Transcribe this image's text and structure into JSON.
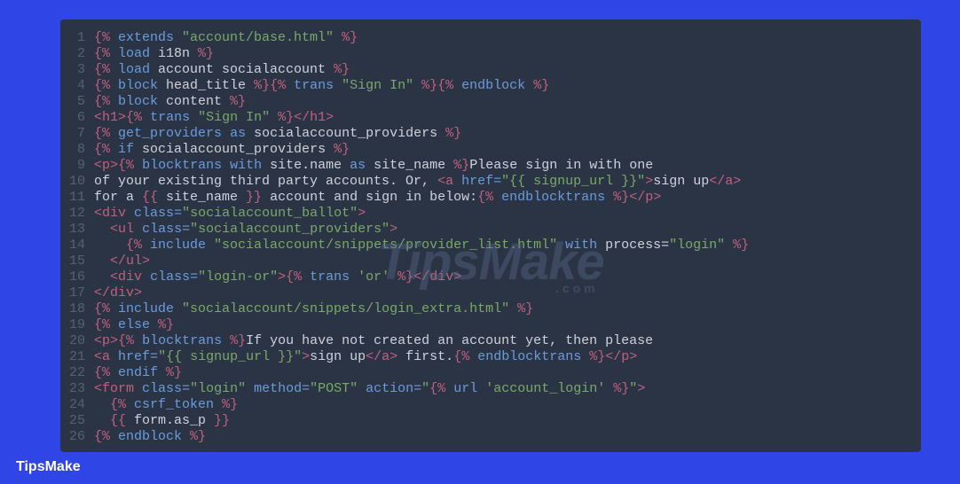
{
  "footer": "TipsMake",
  "watermark": {
    "main": "TipsMake",
    "sub": ".com"
  },
  "lines": [
    {
      "n": 1,
      "tokens": [
        [
          "{% ",
          "delim"
        ],
        [
          "extends",
          "kw"
        ],
        [
          " \"account/base.html\" ",
          "str"
        ],
        [
          "%}",
          "delim"
        ]
      ]
    },
    {
      "n": 2,
      "tokens": [
        [
          "{% ",
          "delim"
        ],
        [
          "load",
          "kw"
        ],
        [
          " i18n ",
          "plain"
        ],
        [
          "%}",
          "delim"
        ]
      ]
    },
    {
      "n": 3,
      "tokens": [
        [
          "{% ",
          "delim"
        ],
        [
          "load",
          "kw"
        ],
        [
          " account socialaccount ",
          "plain"
        ],
        [
          "%}",
          "delim"
        ]
      ]
    },
    {
      "n": 4,
      "tokens": [
        [
          "{% ",
          "delim"
        ],
        [
          "block",
          "kw"
        ],
        [
          " head_title ",
          "plain"
        ],
        [
          "%}",
          "delim"
        ],
        [
          "{% ",
          "delim"
        ],
        [
          "trans",
          "kw"
        ],
        [
          " \"Sign In\" ",
          "str"
        ],
        [
          "%}",
          "delim"
        ],
        [
          "{% ",
          "delim"
        ],
        [
          "endblock",
          "kw"
        ],
        [
          " ",
          "plain"
        ],
        [
          "%}",
          "delim"
        ]
      ]
    },
    {
      "n": 5,
      "tokens": [
        [
          "{% ",
          "delim"
        ],
        [
          "block",
          "kw"
        ],
        [
          " content ",
          "plain"
        ],
        [
          "%}",
          "delim"
        ]
      ]
    },
    {
      "n": 6,
      "tokens": [
        [
          "<",
          "htag"
        ],
        [
          "h1",
          "hname"
        ],
        [
          ">",
          "htag"
        ],
        [
          "{% ",
          "delim"
        ],
        [
          "trans",
          "kw"
        ],
        [
          " \"Sign In\" ",
          "str"
        ],
        [
          "%}",
          "delim"
        ],
        [
          "</",
          "htag"
        ],
        [
          "h1",
          "hname"
        ],
        [
          ">",
          "htag"
        ]
      ]
    },
    {
      "n": 7,
      "tokens": [
        [
          "{% ",
          "delim"
        ],
        [
          "get_providers",
          "kw"
        ],
        [
          " ",
          "plain"
        ],
        [
          "as",
          "kw"
        ],
        [
          " socialaccount_providers ",
          "plain"
        ],
        [
          "%}",
          "delim"
        ]
      ]
    },
    {
      "n": 8,
      "tokens": [
        [
          "{% ",
          "delim"
        ],
        [
          "if",
          "kw"
        ],
        [
          " socialaccount_providers ",
          "plain"
        ],
        [
          "%}",
          "delim"
        ]
      ]
    },
    {
      "n": 9,
      "tokens": [
        [
          "<",
          "htag"
        ],
        [
          "p",
          "hname"
        ],
        [
          ">",
          "htag"
        ],
        [
          "{% ",
          "delim"
        ],
        [
          "blocktrans",
          "kw"
        ],
        [
          " ",
          "plain"
        ],
        [
          "with",
          "kw"
        ],
        [
          " site.name ",
          "var"
        ],
        [
          "as",
          "kw"
        ],
        [
          " site_name ",
          "var"
        ],
        [
          "%}",
          "delim"
        ],
        [
          "Please sign in with one",
          "plain"
        ]
      ]
    },
    {
      "n": 10,
      "tokens": [
        [
          "of your existing third party accounts. Or, ",
          "plain"
        ],
        [
          "<",
          "htag"
        ],
        [
          "a",
          "hname"
        ],
        [
          " ",
          "plain"
        ],
        [
          "href=",
          "attr"
        ],
        [
          "\"{{ signup_url }}\"",
          "attrval"
        ],
        [
          ">",
          "htag"
        ],
        [
          "sign up",
          "plain"
        ],
        [
          "</",
          "htag"
        ],
        [
          "a",
          "hname"
        ],
        [
          ">",
          "htag"
        ]
      ]
    },
    {
      "n": 11,
      "tokens": [
        [
          "for a ",
          "plain"
        ],
        [
          "{{ ",
          "delim"
        ],
        [
          "site_name",
          "var"
        ],
        [
          " }}",
          "delim"
        ],
        [
          " account and sign in below:",
          "plain"
        ],
        [
          "{% ",
          "delim"
        ],
        [
          "endblocktrans",
          "kw"
        ],
        [
          " ",
          "plain"
        ],
        [
          "%}",
          "delim"
        ],
        [
          "</",
          "htag"
        ],
        [
          "p",
          "hname"
        ],
        [
          ">",
          "htag"
        ]
      ]
    },
    {
      "n": 12,
      "tokens": [
        [
          "<",
          "htag"
        ],
        [
          "div",
          "hname"
        ],
        [
          " ",
          "plain"
        ],
        [
          "class=",
          "attr"
        ],
        [
          "\"socialaccount_ballot\"",
          "attrval"
        ],
        [
          ">",
          "htag"
        ]
      ]
    },
    {
      "n": 13,
      "tokens": [
        [
          "  ",
          "plain"
        ],
        [
          "<",
          "htag"
        ],
        [
          "ul",
          "hname"
        ],
        [
          " ",
          "plain"
        ],
        [
          "class=",
          "attr"
        ],
        [
          "\"socialaccount_providers\"",
          "attrval"
        ],
        [
          ">",
          "htag"
        ]
      ]
    },
    {
      "n": 14,
      "tokens": [
        [
          "    ",
          "plain"
        ],
        [
          "{% ",
          "delim"
        ],
        [
          "include",
          "kw"
        ],
        [
          " \"socialaccount/snippets/provider_list.html\" ",
          "str"
        ],
        [
          "with",
          "kw"
        ],
        [
          " process=",
          "plain"
        ],
        [
          "\"login\" ",
          "str"
        ],
        [
          "%}",
          "delim"
        ]
      ]
    },
    {
      "n": 15,
      "tokens": [
        [
          "  ",
          "plain"
        ],
        [
          "</",
          "htag"
        ],
        [
          "ul",
          "hname"
        ],
        [
          ">",
          "htag"
        ]
      ]
    },
    {
      "n": 16,
      "tokens": [
        [
          "  ",
          "plain"
        ],
        [
          "<",
          "htag"
        ],
        [
          "div",
          "hname"
        ],
        [
          " ",
          "plain"
        ],
        [
          "class=",
          "attr"
        ],
        [
          "\"login-or\"",
          "attrval"
        ],
        [
          ">",
          "htag"
        ],
        [
          "{% ",
          "delim"
        ],
        [
          "trans",
          "kw"
        ],
        [
          " 'or' ",
          "str"
        ],
        [
          "%}",
          "delim"
        ],
        [
          "</",
          "htag"
        ],
        [
          "div",
          "hname"
        ],
        [
          ">",
          "htag"
        ]
      ]
    },
    {
      "n": 17,
      "tokens": [
        [
          "</",
          "htag"
        ],
        [
          "div",
          "hname"
        ],
        [
          ">",
          "htag"
        ]
      ]
    },
    {
      "n": 18,
      "tokens": [
        [
          "{% ",
          "delim"
        ],
        [
          "include",
          "kw"
        ],
        [
          " \"socialaccount/snippets/login_extra.html\" ",
          "str"
        ],
        [
          "%}",
          "delim"
        ]
      ]
    },
    {
      "n": 19,
      "tokens": [
        [
          "{% ",
          "delim"
        ],
        [
          "else",
          "kw"
        ],
        [
          " ",
          "plain"
        ],
        [
          "%}",
          "delim"
        ]
      ]
    },
    {
      "n": 20,
      "tokens": [
        [
          "<",
          "htag"
        ],
        [
          "p",
          "hname"
        ],
        [
          ">",
          "htag"
        ],
        [
          "{% ",
          "delim"
        ],
        [
          "blocktrans",
          "kw"
        ],
        [
          " ",
          "plain"
        ],
        [
          "%}",
          "delim"
        ],
        [
          "If you have not created an account yet, then please",
          "plain"
        ]
      ]
    },
    {
      "n": 21,
      "tokens": [
        [
          "<",
          "htag"
        ],
        [
          "a",
          "hname"
        ],
        [
          " ",
          "plain"
        ],
        [
          "href=",
          "attr"
        ],
        [
          "\"{{ signup_url }}\"",
          "attrval"
        ],
        [
          ">",
          "htag"
        ],
        [
          "sign up",
          "plain"
        ],
        [
          "</",
          "htag"
        ],
        [
          "a",
          "hname"
        ],
        [
          ">",
          "htag"
        ],
        [
          " first.",
          "plain"
        ],
        [
          "{% ",
          "delim"
        ],
        [
          "endblocktrans",
          "kw"
        ],
        [
          " ",
          "plain"
        ],
        [
          "%}",
          "delim"
        ],
        [
          "</",
          "htag"
        ],
        [
          "p",
          "hname"
        ],
        [
          ">",
          "htag"
        ]
      ]
    },
    {
      "n": 22,
      "tokens": [
        [
          "{% ",
          "delim"
        ],
        [
          "endif",
          "kw"
        ],
        [
          " ",
          "plain"
        ],
        [
          "%}",
          "delim"
        ]
      ]
    },
    {
      "n": 23,
      "tokens": [
        [
          "<",
          "htag"
        ],
        [
          "form",
          "hname"
        ],
        [
          " ",
          "plain"
        ],
        [
          "class=",
          "attr"
        ],
        [
          "\"login\"",
          "attrval"
        ],
        [
          " ",
          "plain"
        ],
        [
          "method=",
          "attr"
        ],
        [
          "\"POST\"",
          "attrval"
        ],
        [
          " ",
          "plain"
        ],
        [
          "action=",
          "attr"
        ],
        [
          "\"",
          "attrval"
        ],
        [
          "{% ",
          "delim"
        ],
        [
          "url",
          "kw"
        ],
        [
          " 'account_login' ",
          "str"
        ],
        [
          "%}",
          "delim"
        ],
        [
          "\"",
          "attrval"
        ],
        [
          ">",
          "htag"
        ]
      ]
    },
    {
      "n": 24,
      "tokens": [
        [
          "  ",
          "plain"
        ],
        [
          "{% ",
          "delim"
        ],
        [
          "csrf_token",
          "kw"
        ],
        [
          " ",
          "plain"
        ],
        [
          "%}",
          "delim"
        ]
      ]
    },
    {
      "n": 25,
      "tokens": [
        [
          "  ",
          "plain"
        ],
        [
          "{{ ",
          "delim"
        ],
        [
          "form.as_p",
          "var"
        ],
        [
          " }}",
          "delim"
        ]
      ]
    },
    {
      "n": 26,
      "tokens": [
        [
          "{% ",
          "delim"
        ],
        [
          "endblock",
          "kw"
        ],
        [
          " ",
          "plain"
        ],
        [
          "%}",
          "delim"
        ]
      ]
    }
  ]
}
